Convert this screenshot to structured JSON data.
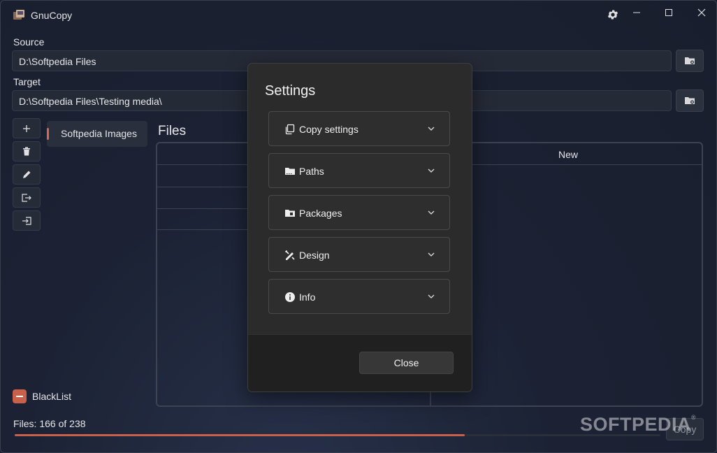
{
  "window": {
    "title": "GnuCopy"
  },
  "source": {
    "label": "Source",
    "value": "D:\\Softpedia Files"
  },
  "target": {
    "label": "Target",
    "value": "D:\\Softpedia Files\\Testing media\\"
  },
  "packages": [
    {
      "label": "Softpedia Images",
      "selected": true
    }
  ],
  "files": {
    "title": "Files",
    "columns": [
      "",
      "New"
    ]
  },
  "blacklist": {
    "label": "BlackList",
    "checked": true
  },
  "status": {
    "files_count": "Files: 166 of 238",
    "progress": 0.697
  },
  "copy_button": {
    "label": "Copy"
  },
  "watermark": {
    "text": "SOFTPEDIA",
    "mark": "®"
  },
  "dialog": {
    "title": "Settings",
    "sections": [
      {
        "label": "Copy settings",
        "icon": "copy-icon"
      },
      {
        "label": "Paths",
        "icon": "folder-icon"
      },
      {
        "label": "Packages",
        "icon": "package-folder-icon"
      },
      {
        "label": "Design",
        "icon": "design-tools-icon"
      },
      {
        "label": "Info",
        "icon": "info-icon"
      }
    ],
    "close_label": "Close"
  },
  "colors": {
    "accent": "#c8604c",
    "background": "#1b2133",
    "dialog": "#2b2b2b"
  }
}
